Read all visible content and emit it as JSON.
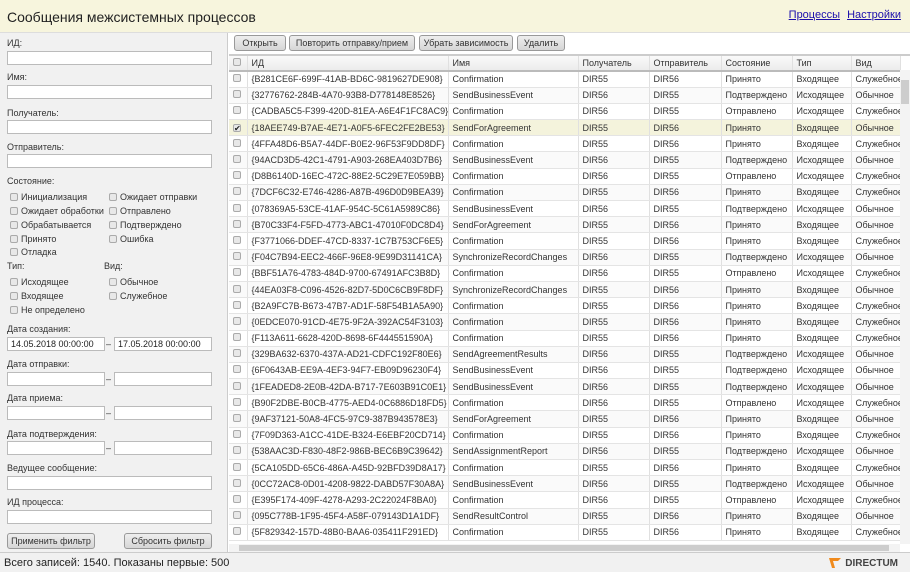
{
  "header": {
    "title": "Сообщения межсистемных процессов",
    "links": [
      "Процессы",
      "Настройки"
    ]
  },
  "filter": {
    "id_label": "ИД:",
    "name_label": "Имя:",
    "recipient_label": "Получатель:",
    "sender_label": "Отправитель:",
    "state_label": "Состояние:",
    "states": [
      "Инициализация",
      "Ожидает отправки",
      "Ожидает обработки",
      "Отправлено",
      "Обрабатывается",
      "Подтверждено",
      "Принято",
      "Ошибка",
      "Отладка"
    ],
    "type_label": "Тип:",
    "types": [
      "Исходящее",
      "Входящее",
      "Не определено"
    ],
    "kind_label": "Вид:",
    "kinds": [
      "Обычное",
      "Служебное"
    ],
    "created_label": "Дата создания:",
    "created_from": "14.05.2018 00:00:00",
    "created_to": "17.05.2018 00:00:00",
    "sent_label": "Дата отправки:",
    "received_label": "Дата приема:",
    "confirmed_label": "Дата подтверждения:",
    "lead_label": "Ведущее сообщение:",
    "process_label": "ИД процесса:",
    "apply": "Применить фильтр",
    "reset": "Сбросить фильтр",
    "dash": "–"
  },
  "toolbar": {
    "open": "Открыть",
    "retry": "Повторить отправку/прием",
    "remove_dep": "Убрать зависимость",
    "delete": "Удалить"
  },
  "table": {
    "columns": [
      "ИД",
      "Имя",
      "Получатель",
      "Отправитель",
      "Состояние",
      "Тип",
      "Вид"
    ],
    "rows": [
      [
        "{B281CE6F-699F-41AB-BD6C-9819627DE908}",
        "Confirmation",
        "DIR55",
        "DIR56",
        "Принято",
        "Входящее",
        "Служебное"
      ],
      [
        "{32776762-284B-4A70-93B8-D778148E8526}",
        "SendBusinessEvent",
        "DIR56",
        "DIR55",
        "Подтверждено",
        "Исходящее",
        "Обычное"
      ],
      [
        "{CADBA5C5-F399-420D-81EA-A6E4F1FC8AC9}",
        "Confirmation",
        "DIR56",
        "DIR55",
        "Отправлено",
        "Исходящее",
        "Служебное"
      ],
      [
        "{18AEE749-B7AE-4E71-A0F5-6FEC2FE2BE53}",
        "SendForAgreement",
        "DIR55",
        "DIR56",
        "Принято",
        "Входящее",
        "Обычное"
      ],
      [
        "{4FFA48D6-B5A7-44DF-B0E2-96F53F9DD8DF}",
        "Confirmation",
        "DIR55",
        "DIR56",
        "Принято",
        "Входящее",
        "Служебное"
      ],
      [
        "{94ACD3D5-42C1-4791-A903-268EA403D7B6}",
        "SendBusinessEvent",
        "DIR56",
        "DIR55",
        "Подтверждено",
        "Исходящее",
        "Обычное"
      ],
      [
        "{D8B6140D-16EC-472C-88E2-5C29E7E059BB}",
        "Confirmation",
        "DIR56",
        "DIR55",
        "Отправлено",
        "Исходящее",
        "Служебное"
      ],
      [
        "{7DCF6C32-E746-4286-A87B-496D0D9BEA39}",
        "Confirmation",
        "DIR55",
        "DIR56",
        "Принято",
        "Входящее",
        "Служебное"
      ],
      [
        "{078369A5-53CE-41AF-954C-5C61A5989C86}",
        "SendBusinessEvent",
        "DIR56",
        "DIR55",
        "Подтверждено",
        "Исходящее",
        "Обычное"
      ],
      [
        "{B70C33F4-F5FD-4773-ABC1-47010F0DC8D4}",
        "SendForAgreement",
        "DIR55",
        "DIR56",
        "Принято",
        "Входящее",
        "Обычное"
      ],
      [
        "{F3771066-DDEF-47CD-8337-1C7B753CF6E5}",
        "Confirmation",
        "DIR55",
        "DIR56",
        "Принято",
        "Входящее",
        "Служебное"
      ],
      [
        "{F04C7B94-EEC2-466F-96E8-9E99D31141CA}",
        "SynchronizeRecordChanges",
        "DIR56",
        "DIR55",
        "Подтверждено",
        "Исходящее",
        "Обычное"
      ],
      [
        "{BBF51A76-4783-484D-9700-67491AFC3B8D}",
        "Confirmation",
        "DIR56",
        "DIR55",
        "Отправлено",
        "Исходящее",
        "Служебное"
      ],
      [
        "{44EA03F8-C096-4526-82D7-5D0C6CB9F8DF}",
        "SynchronizeRecordChanges",
        "DIR55",
        "DIR56",
        "Принято",
        "Входящее",
        "Обычное"
      ],
      [
        "{B2A9FC7B-B673-47B7-AD1F-58F54B1A5A90}",
        "Confirmation",
        "DIR55",
        "DIR56",
        "Принято",
        "Входящее",
        "Служебное"
      ],
      [
        "{0EDCE070-91CD-4E75-9F2A-392AC54F3103}",
        "Confirmation",
        "DIR55",
        "DIR56",
        "Принято",
        "Входящее",
        "Служебное"
      ],
      [
        "{F113A611-6628-420D-8698-6F444551590A}",
        "Confirmation",
        "DIR55",
        "DIR56",
        "Принято",
        "Входящее",
        "Служебное"
      ],
      [
        "{329BA632-6370-437A-AD21-CDFC192F80E6}",
        "SendAgreementResults",
        "DIR56",
        "DIR55",
        "Подтверждено",
        "Исходящее",
        "Обычное"
      ],
      [
        "{6F0643AB-EE9A-4EF3-94F7-EB09D96230F4}",
        "SendBusinessEvent",
        "DIR56",
        "DIR55",
        "Подтверждено",
        "Исходящее",
        "Обычное"
      ],
      [
        "{1FEADED8-2E0B-42DA-B717-7E603B91C0E1}",
        "SendBusinessEvent",
        "DIR56",
        "DIR55",
        "Подтверждено",
        "Исходящее",
        "Обычное"
      ],
      [
        "{B90F2DBE-B0CB-4775-AED4-0C6886D18FD5}",
        "Confirmation",
        "DIR56",
        "DIR55",
        "Отправлено",
        "Исходящее",
        "Служебное"
      ],
      [
        "{9AF37121-50A8-4FC5-97C9-387B943578E3}",
        "SendForAgreement",
        "DIR55",
        "DIR56",
        "Принято",
        "Входящее",
        "Обычное"
      ],
      [
        "{7F09D363-A1CC-41DE-B324-E6EBF20CD714}",
        "Confirmation",
        "DIR55",
        "DIR56",
        "Принято",
        "Входящее",
        "Служебное"
      ],
      [
        "{538AAC3D-F830-48F2-986B-BEC6B9C39642}",
        "SendAssignmentReport",
        "DIR56",
        "DIR55",
        "Подтверждено",
        "Исходящее",
        "Обычное"
      ],
      [
        "{5CA105DD-65C6-486A-A45D-92BFD39D8A17}",
        "Confirmation",
        "DIR55",
        "DIR56",
        "Принято",
        "Входящее",
        "Служебное"
      ],
      [
        "{0CC72AC8-0D01-4208-9822-DABD57F30A8A}",
        "SendBusinessEvent",
        "DIR56",
        "DIR55",
        "Подтверждено",
        "Исходящее",
        "Обычное"
      ],
      [
        "{E395F174-409F-4278-A293-2C22024F8BA0}",
        "Confirmation",
        "DIR56",
        "DIR55",
        "Отправлено",
        "Исходящее",
        "Служебное"
      ],
      [
        "{095C778B-1F95-45F4-A58F-079143D1A1DF}",
        "SendResultControl",
        "DIR55",
        "DIR56",
        "Принято",
        "Входящее",
        "Обычное"
      ],
      [
        "{5F829342-157D-48B0-BAA6-035411F291ED}",
        "Confirmation",
        "DIR55",
        "DIR56",
        "Принято",
        "Входящее",
        "Служебное"
      ]
    ],
    "selected_row": 3
  },
  "footer": {
    "status": "Всего записей: 1540. Показаны первые: 500",
    "logo": "DIRECTUM"
  },
  "colors": {
    "header_bg": "#f7f5dd",
    "selected_row": "#f4f3dc",
    "logo_orange": "#f08a1c"
  }
}
